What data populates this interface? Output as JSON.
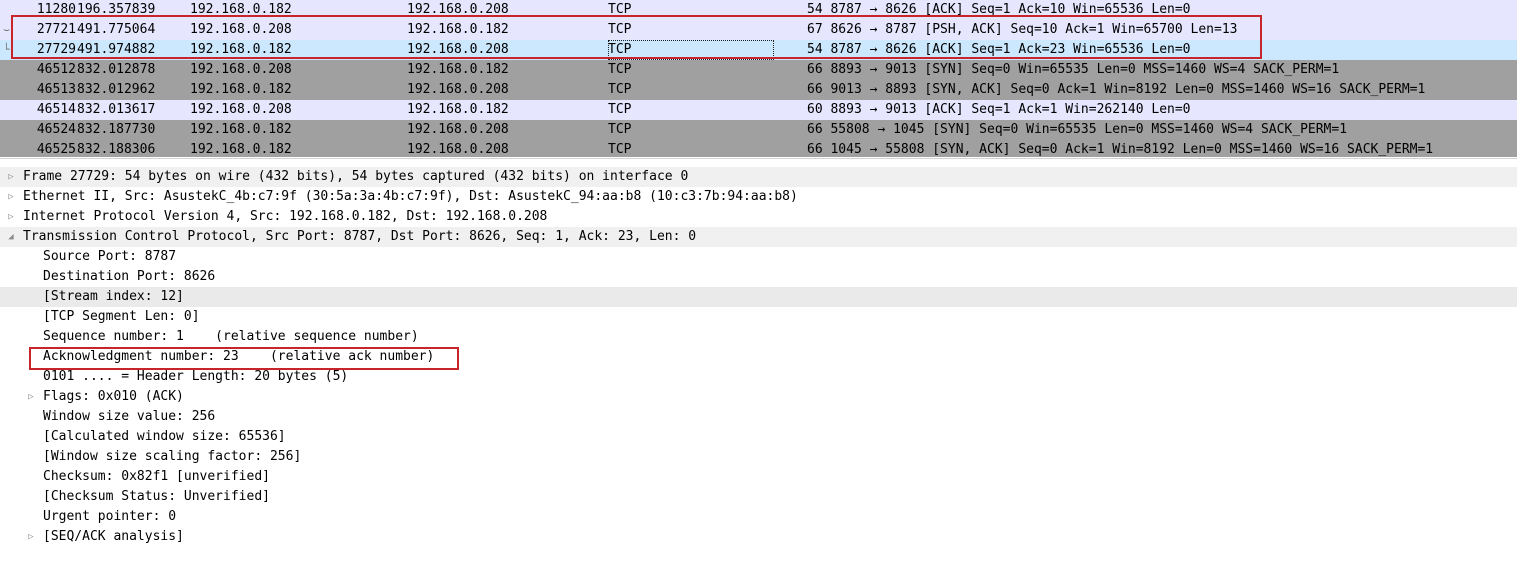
{
  "packet_list": {
    "rows": [
      {
        "no": "11280",
        "time": "196.357839",
        "source": "192.168.0.182",
        "destination": "192.168.0.208",
        "protocol": "TCP",
        "info": "54 8787 → 8626 [ACK] Seq=1 Ack=10 Win=65536 Len=0",
        "style": "light",
        "mark": ""
      },
      {
        "no": "27721",
        "time": "491.775064",
        "source": "192.168.0.208",
        "destination": "192.168.0.182",
        "protocol": "TCP",
        "info": "67 8626 → 8787 [PSH, ACK] Seq=10 Ack=1 Win=65700 Len=13",
        "style": "light",
        "mark": "⌣"
      },
      {
        "no": "27729",
        "time": "491.974882",
        "source": "192.168.0.182",
        "destination": "192.168.0.208",
        "protocol": "TCP",
        "info": "54 8787 → 8626 [ACK] Seq=1 Ack=23 Win=65536 Len=0",
        "style": "selected",
        "mark": "└"
      },
      {
        "no": "46512",
        "time": "832.012878",
        "source": "192.168.0.208",
        "destination": "192.168.0.182",
        "protocol": "TCP",
        "info": "66 8893 → 9013 [SYN] Seq=0 Win=65535 Len=0 MSS=1460 WS=4 SACK_PERM=1",
        "style": "gray",
        "mark": ""
      },
      {
        "no": "46513",
        "time": "832.012962",
        "source": "192.168.0.182",
        "destination": "192.168.0.208",
        "protocol": "TCP",
        "info": "66 9013 → 8893 [SYN, ACK] Seq=0 Ack=1 Win=8192 Len=0 MSS=1460 WS=16 SACK_PERM=1",
        "style": "gray",
        "mark": ""
      },
      {
        "no": "46514",
        "time": "832.013617",
        "source": "192.168.0.208",
        "destination": "192.168.0.182",
        "protocol": "TCP",
        "info": "60 8893 → 9013 [ACK] Seq=1 Ack=1 Win=262140 Len=0",
        "style": "light",
        "mark": ""
      },
      {
        "no": "46524",
        "time": "832.187730",
        "source": "192.168.0.182",
        "destination": "192.168.0.208",
        "protocol": "TCP",
        "info": "66 55808 → 1045 [SYN] Seq=0 Win=65535 Len=0 MSS=1460 WS=4 SACK_PERM=1",
        "style": "gray",
        "mark": ""
      },
      {
        "no": "46525",
        "time": "832.188306",
        "source": "192.168.0.182",
        "destination": "192.168.0.208",
        "protocol": "TCP",
        "info": "66 1045 → 55808 [SYN, ACK] Seq=0 Ack=1 Win=8192 Len=0 MSS=1460 WS=16 SACK_PERM=1",
        "style": "gray",
        "mark": ""
      }
    ]
  },
  "details": {
    "rows": [
      {
        "text": "Frame 27729: 54 bytes on wire (432 bits), 54 bytes captured (432 bits) on interface 0",
        "indent": 0,
        "expander": "collapsed",
        "style": "top"
      },
      {
        "text": "Ethernet II, Src: AsustekC_4b:c7:9f (30:5a:3a:4b:c7:9f), Dst: AsustekC_94:aa:b8 (10:c3:7b:94:aa:b8)",
        "indent": 0,
        "expander": "collapsed",
        "style": ""
      },
      {
        "text": "Internet Protocol Version 4, Src: 192.168.0.182, Dst: 192.168.0.208",
        "indent": 0,
        "expander": "collapsed",
        "style": ""
      },
      {
        "text": "Transmission Control Protocol, Src Port: 8787, Dst Port: 8626, Seq: 1, Ack: 23, Len: 0",
        "indent": 0,
        "expander": "expanded",
        "style": "top"
      },
      {
        "text": "Source Port: 8787",
        "indent": 1,
        "expander": "none",
        "style": ""
      },
      {
        "text": "Destination Port: 8626",
        "indent": 1,
        "expander": "none",
        "style": ""
      },
      {
        "text": "[Stream index: 12]",
        "indent": 1,
        "expander": "none",
        "style": "sel"
      },
      {
        "text": "[TCP Segment Len: 0]",
        "indent": 1,
        "expander": "none",
        "style": ""
      },
      {
        "text": "Sequence number: 1    (relative sequence number)",
        "indent": 1,
        "expander": "none",
        "style": ""
      },
      {
        "text": "Acknowledgment number: 23    (relative ack number)",
        "indent": 1,
        "expander": "none",
        "style": ""
      },
      {
        "text": "0101 .... = Header Length: 20 bytes (5)",
        "indent": 1,
        "expander": "none",
        "style": ""
      },
      {
        "text": "Flags: 0x010 (ACK)",
        "indent": 1,
        "expander": "collapsed",
        "style": ""
      },
      {
        "text": "Window size value: 256",
        "indent": 1,
        "expander": "none",
        "style": ""
      },
      {
        "text": "[Calculated window size: 65536]",
        "indent": 1,
        "expander": "none",
        "style": ""
      },
      {
        "text": "[Window size scaling factor: 256]",
        "indent": 1,
        "expander": "none",
        "style": ""
      },
      {
        "text": "Checksum: 0x82f1 [unverified]",
        "indent": 1,
        "expander": "none",
        "style": ""
      },
      {
        "text": "[Checksum Status: Unverified]",
        "indent": 1,
        "expander": "none",
        "style": ""
      },
      {
        "text": "Urgent pointer: 0",
        "indent": 1,
        "expander": "none",
        "style": ""
      },
      {
        "text": "[SEQ/ACK analysis]",
        "indent": 1,
        "expander": "collapsed",
        "style": ""
      }
    ]
  },
  "icons": {
    "collapsed": "▷",
    "expanded": "◢"
  },
  "colors": {
    "highlight_box": "#c8242b",
    "row_light": "#e7e6ff",
    "row_selected": "#cce8ff",
    "row_gray": "#a0a0a0"
  }
}
